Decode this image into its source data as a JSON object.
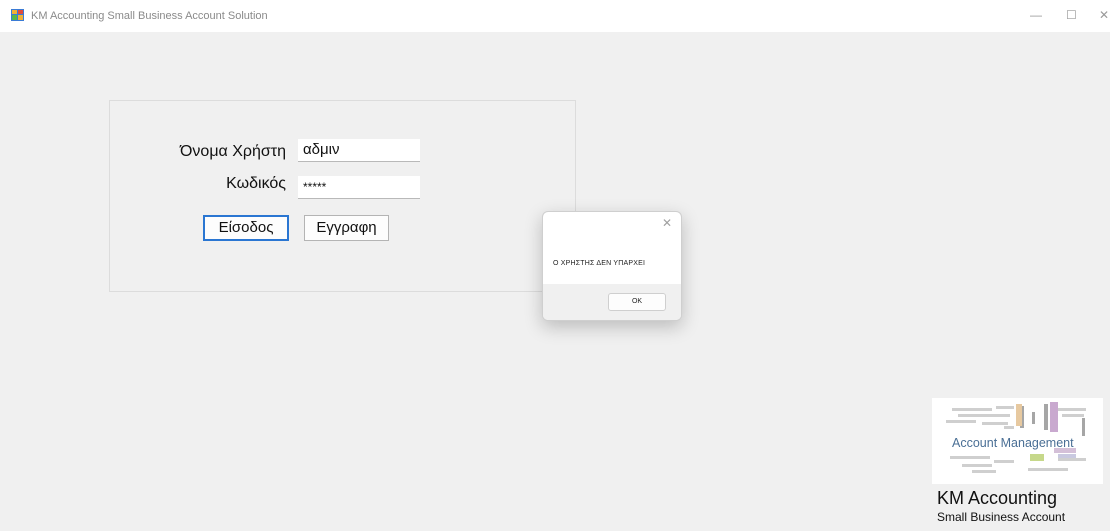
{
  "window": {
    "title": "KM Accounting Small Business Account Solution",
    "minimize_glyph": "—",
    "maximize_glyph": "☐",
    "close_glyph": "✕"
  },
  "login": {
    "username_label": "Όνομα Χρήστη",
    "username_value": "αδμιν",
    "password_label": "Κωδικός",
    "password_value": "*****",
    "login_button": "Είσοδος",
    "register_button": "Εγγραφη"
  },
  "message_box": {
    "close_glyph": "✕",
    "text": "Ο ΧΡΗΣΤΗΣ ΔΕΝ ΥΠΑΡΧΕΙ",
    "ok_label": "OK"
  },
  "branding": {
    "logo_text": "Account Management",
    "title": "KM Accounting",
    "subtitle": "Small Business Account"
  },
  "icons": [
    "app-icon",
    "word-cloud-logo"
  ]
}
